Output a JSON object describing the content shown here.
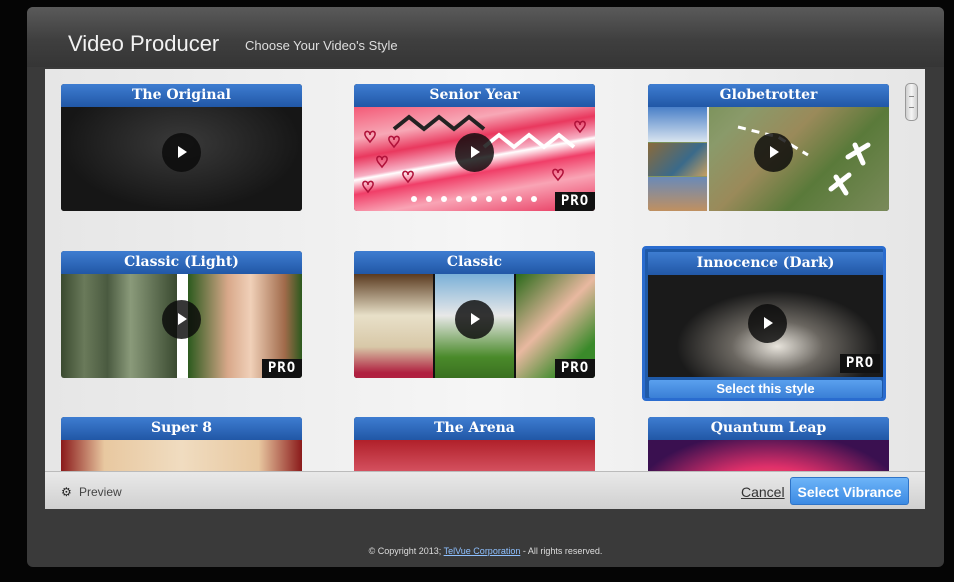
{
  "header": {
    "title": "Video Producer",
    "subtitle": "Choose Your Video's Style"
  },
  "styles": [
    {
      "name": "The Original",
      "pro": false
    },
    {
      "name": "Senior Year",
      "pro": true,
      "pro_label": "PRO"
    },
    {
      "name": "Globetrotter",
      "pro": false
    },
    {
      "name": "Classic (Light)",
      "pro": true,
      "pro_label": "PRO"
    },
    {
      "name": "Classic",
      "pro": true,
      "pro_label": "PRO"
    },
    {
      "name": "Innocence (Dark)",
      "pro": true,
      "pro_label": "PRO",
      "selected": true,
      "select_label": "Select this style"
    },
    {
      "name": "Super 8"
    },
    {
      "name": "The Arena"
    },
    {
      "name": "Quantum Leap"
    }
  ],
  "footer": {
    "preview_label": "Preview",
    "cancel_label": "Cancel",
    "select_label": "Select Vibrance"
  },
  "copyright": {
    "prefix": "© Copyright 2013;",
    "link": "TelVue Corporation",
    "suffix": "- All rights reserved."
  },
  "colors": {
    "title_bar": "#2b64b8",
    "accent": "#4a96ec",
    "window": "#3a3a3a"
  }
}
